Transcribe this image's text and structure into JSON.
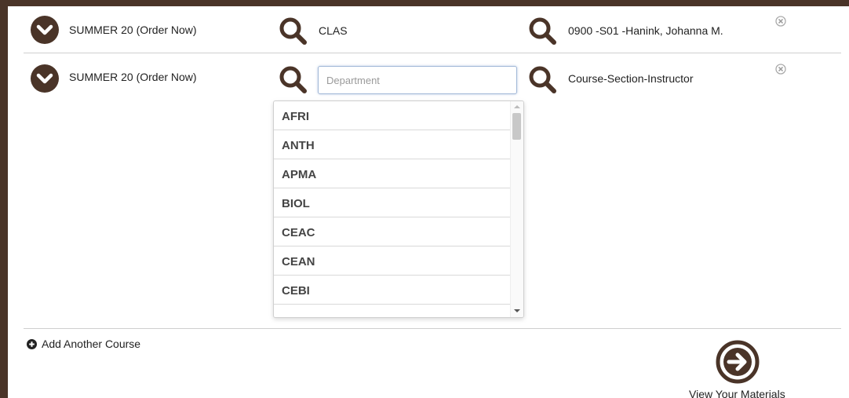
{
  "colors": {
    "accent": "#4a3428",
    "border": "#cfcfcf",
    "input_focus": "#9fb6d6"
  },
  "rows": [
    {
      "term": "SUMMER 20 (Order Now)",
      "department": "CLAS",
      "course_section": "0900 -S01 -Hanink, Johanna M."
    },
    {
      "term": "SUMMER 20 (Order Now)",
      "department_placeholder": "Department",
      "department_value": "",
      "course_section": "Course-Section-Instructor"
    }
  ],
  "dropdown": {
    "options": [
      "AFRI",
      "ANTH",
      "APMA",
      "BIOL",
      "CEAC",
      "CEAN",
      "CEBI"
    ]
  },
  "add_course_label": "Add Another Course",
  "view_materials_label": "View Your Materials",
  "icons": {
    "chevron": "chevron-down-circle-icon",
    "search": "magnifier-icon",
    "remove": "close-circle-icon",
    "add": "plus-circle-icon",
    "proceed": "arrow-right-circle-icon"
  }
}
